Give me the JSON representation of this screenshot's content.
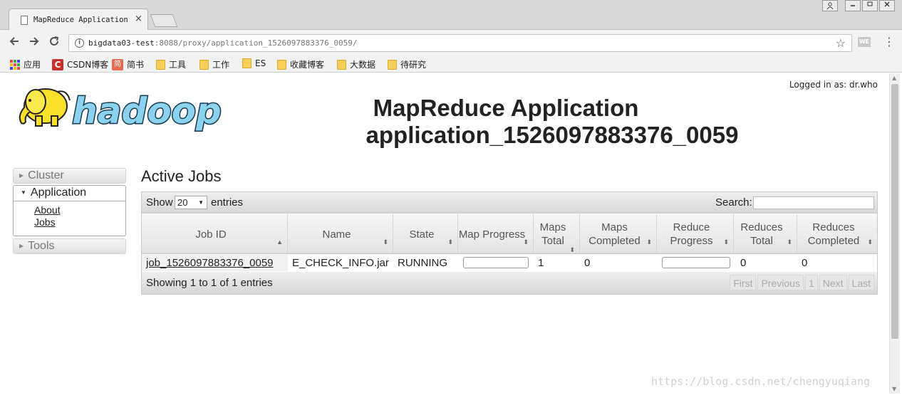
{
  "browser": {
    "tab_title": "MapReduce Application",
    "tab_close": "×",
    "url_host": "bigdata03-test",
    "url_rest": ":8088/proxy/application_1526097883376_0059/",
    "ext_label": "WE",
    "bookmarks": [
      {
        "label": "应用",
        "icon": "apps-icon"
      },
      {
        "label": "CSDN博客",
        "icon": "csdn-icon"
      },
      {
        "label": "简书",
        "icon": "jianshu-icon"
      },
      {
        "label": "工具",
        "icon": "folder-icon"
      },
      {
        "label": "工作",
        "icon": "folder-icon"
      },
      {
        "label": "ES",
        "icon": "folder-icon"
      },
      {
        "label": "收藏博客",
        "icon": "folder-icon"
      },
      {
        "label": "大数据",
        "icon": "folder-icon"
      },
      {
        "label": "待研究",
        "icon": "folder-icon"
      }
    ]
  },
  "header": {
    "logged_in": "Logged in as: dr.who",
    "logo_text": "hadoop",
    "title": "MapReduce Application",
    "subtitle": "application_1526097883376_0059"
  },
  "nav": {
    "cluster": "Cluster",
    "application": "Application",
    "about": "About",
    "jobs": "Jobs",
    "tools": "Tools"
  },
  "content": {
    "section_title": "Active Jobs",
    "show_label": "Show",
    "page_size": "20",
    "entries_label": "entries",
    "search_label": "Search:",
    "search_value": "",
    "columns": [
      "Job ID",
      "Name",
      "State",
      "Map Progress",
      "Maps Total",
      "Maps Completed",
      "Reduce Progress",
      "Reduces Total",
      "Reduces Completed"
    ],
    "rows": [
      {
        "job_id": "job_1526097883376_0059",
        "name": "E_CHECK_INFO.jar",
        "state": "RUNNING",
        "map_progress": 0,
        "maps_total": "1",
        "maps_completed": "0",
        "reduce_progress": 0,
        "reduces_total": "0",
        "reduces_completed": "0"
      }
    ],
    "info": "Showing 1 to 1 of 1 entries",
    "pager": {
      "first": "First",
      "previous": "Previous",
      "page": "1",
      "next": "Next",
      "last": "Last"
    }
  },
  "watermark": "https://blog.csdn.net/chengyuqiang"
}
